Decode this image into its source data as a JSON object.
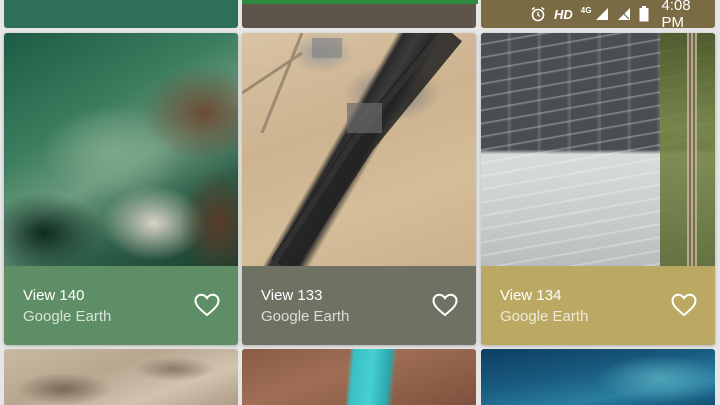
{
  "status_bar": {
    "hd": "HD",
    "network": "4G",
    "time": "4:08 PM"
  },
  "cards": [
    {
      "title": "View 140",
      "subtitle": "Google Earth",
      "footer_color": "#5e8e66"
    },
    {
      "title": "View 133",
      "subtitle": "Google Earth",
      "footer_color": "#6f7262"
    },
    {
      "title": "View 134",
      "subtitle": "Google Earth",
      "footer_color": "#bba963"
    }
  ],
  "icons": {
    "favorite": "heart-outline-icon",
    "alarm": "alarm-clock-icon",
    "signal": "signal-icon",
    "battery": "battery-icon"
  },
  "colors": {
    "background": "#e6e6e6",
    "active_indicator": "#2d8a3e"
  }
}
